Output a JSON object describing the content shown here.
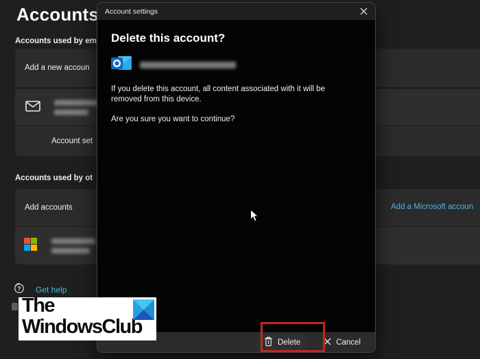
{
  "page": {
    "title": "Accounts",
    "sections": {
      "email_label": "Accounts used by em",
      "other_label": "Accounts used by ot"
    },
    "rows": {
      "add_new_account_label": "Add a new accoun",
      "account_settings_label": "Account set",
      "add_accounts_label": "Add accounts",
      "add_microsoft_account_link": "Add a Microsoft accoun"
    },
    "links": {
      "get_help": "Get help"
    }
  },
  "dialog": {
    "title": "Account settings",
    "heading": "Delete this account?",
    "body_lines": [
      "If you delete this account, all content associated with it will be",
      "removed from this device."
    ],
    "confirm_line": "Are you sure you want to continue?",
    "footer": {
      "delete_label": "Delete",
      "cancel_label": "Cancel"
    }
  },
  "watermark": {
    "line1": "The",
    "line2": "WindowsClub"
  },
  "colors": {
    "accent_link": "#4db6e5",
    "annotation_red": "#c2271d",
    "dialog_body": "#040404",
    "dialog_titlebar": "#1f1f1f",
    "row_background": "#2b2b2b",
    "page_background": "#1f1f1f",
    "ms_red": "#f25022",
    "ms_green": "#7fba00",
    "ms_blue": "#00a4ef",
    "ms_yellow": "#ffb900",
    "outlook_dark": "#0f6cbd",
    "outlook_light": "#29a8ea",
    "wm_diamond_top": "#47c5f1",
    "wm_diamond_side": "#1d8fd6",
    "wm_diamond_bottom": "#1d55b8"
  }
}
